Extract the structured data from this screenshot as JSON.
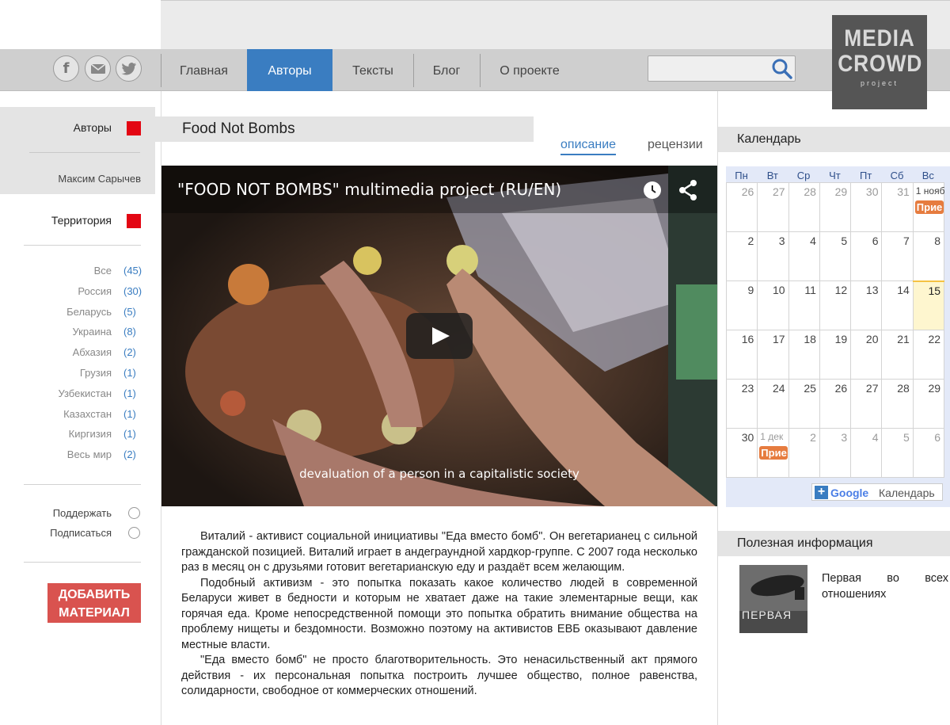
{
  "nav": {
    "social": [
      "f",
      "✉",
      "🐦"
    ],
    "items": [
      {
        "label": "Главная",
        "active": false
      },
      {
        "label": "Авторы",
        "active": true
      },
      {
        "label": "Тексты",
        "active": false
      },
      {
        "label": "Блог",
        "active": false
      },
      {
        "label": "О проекте",
        "active": false
      }
    ],
    "search_placeholder": ""
  },
  "logo": {
    "line1": "MEDIA",
    "line2": "CROWD",
    "line3": "project"
  },
  "sidebar": {
    "authors_label": "Авторы",
    "author_name": "Максим Сарычев",
    "territory_label": "Территория",
    "territories": [
      {
        "name": "Все",
        "count": "(45)"
      },
      {
        "name": "Россия",
        "count": "(30)"
      },
      {
        "name": "Беларусь",
        "count": "(5)"
      },
      {
        "name": "Украина",
        "count": "(8)"
      },
      {
        "name": "Абхазия",
        "count": "(2)"
      },
      {
        "name": "Грузия",
        "count": "(1)"
      },
      {
        "name": "Узбекистан",
        "count": "(1)"
      },
      {
        "name": "Казахстан",
        "count": "(1)"
      },
      {
        "name": "Киргизия",
        "count": "(1)"
      },
      {
        "name": "Весь мир",
        "count": "(2)"
      }
    ],
    "support_label": "Поддержать",
    "subscribe_label": "Подписаться",
    "add_button_line1": "ДОБАВИТЬ",
    "add_button_line2": "МАТЕРИАЛ"
  },
  "main": {
    "title": "Food Not Bombs",
    "tab_description": "описание",
    "tab_reviews": "рецензии",
    "video_title": "\"FOOD NOT BOMBS\" multimedia project (RU/EN)",
    "video_subtitle": "devaluation of a person in a capitalistic society",
    "paragraphs": [
      "Виталий - активист социальной инициативы \"Еда вместо бомб\". Он вегетарианец с сильной гражданской позицией. Виталий играет в андеграундной хардкор-группе. С 2007 года несколько раз в месяц он с друзьями готовит вегетарианскую еду и раздаёт всем желающим.",
      "Подобный активизм - это попытка показать какое количество людей в современной Беларуси живет в бедности и которым не хватает даже на такие элементарные вещи, как горячая еда. Кроме непосредственной помощи это попытка обратить внимание общества на проблему нищеты и бездомности. Возможно поэтому на активистов ЕВБ оказывают давление местные власти.",
      "\"Еда вместо бомб\" не просто благотворительность. Это ненасильственный акт прямого действия - их персональная попытка построить лучшее общество, полное равенства, солидарности, свободное от коммерческих отношений."
    ]
  },
  "calendar": {
    "heading": "Календарь",
    "weekdays": [
      "Пн",
      "Вт",
      "Ср",
      "Чт",
      "Пт",
      "Сб",
      "Вс"
    ],
    "weeks": [
      [
        "26",
        "27",
        "28",
        "29",
        "30",
        "31",
        "1 нояб"
      ],
      [
        "2",
        "3",
        "4",
        "5",
        "6",
        "7",
        "8"
      ],
      [
        "9",
        "10",
        "11",
        "12",
        "13",
        "14",
        "15"
      ],
      [
        "16",
        "17",
        "18",
        "19",
        "20",
        "21",
        "22"
      ],
      [
        "23",
        "24",
        "25",
        "26",
        "27",
        "28",
        "29"
      ],
      [
        "30",
        "1 дек",
        "2",
        "3",
        "4",
        "5",
        "6"
      ]
    ],
    "event_label": "Прие",
    "google_label_google": "Google",
    "google_label_cal": "Календарь",
    "plus": "+"
  },
  "useful": {
    "heading": "Полезная информация",
    "item_title": "Первая во всех отношениях",
    "thumb_text": "ПЕРВАЯ"
  },
  "colors": {
    "accent": "#3a7dc1",
    "red": "#e30613",
    "button": "#d9534f",
    "event": "#e67c3f"
  }
}
